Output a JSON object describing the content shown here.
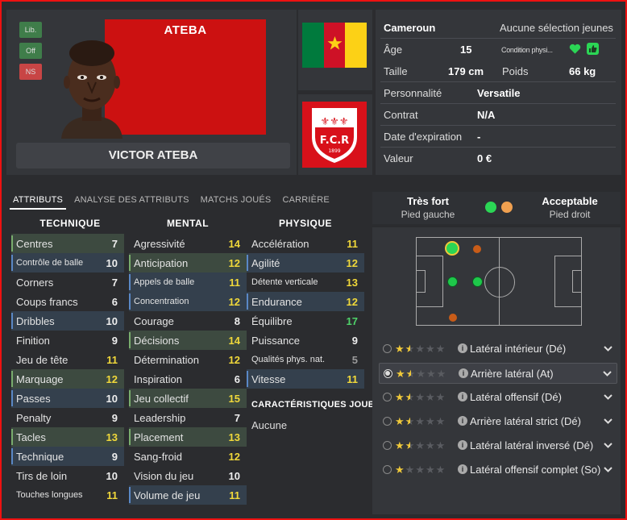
{
  "header": {
    "banner_name": "ATEBA",
    "full_name": "VICTOR ATEBA",
    "tags": [
      "Lib.",
      "Off",
      "NS"
    ]
  },
  "nation": {
    "flag_colors": [
      "#007a3d",
      "#ce1126",
      "#fcd116"
    ],
    "star_color": "#fcd116"
  },
  "club": {
    "badge_color": "#d8111a",
    "badge_text": "F.C.R",
    "year": "1899"
  },
  "info": {
    "country": "Cameroun",
    "selection": "Aucune sélection jeunes",
    "age_label": "Âge",
    "age": "15",
    "condition_label": "Condition physi...",
    "height_label": "Taille",
    "height": "179 cm",
    "weight_label": "Poids",
    "weight": "66 kg",
    "personality_label": "Personnalité",
    "personality": "Versatile",
    "contract_label": "Contrat",
    "contract": "N/A",
    "expiry_label": "Date d'expiration",
    "expiry": "-",
    "value_label": "Valeur",
    "value": "0 €"
  },
  "tabs": [
    "ATTRIBUTS",
    "ANALYSE DES ATTRIBUTS",
    "MATCHS JOUÉS",
    "CARRIÈRE"
  ],
  "sections": {
    "technique": "TECHNIQUE",
    "mental": "MENTAL",
    "physique": "PHYSIQUE"
  },
  "technique": [
    {
      "name": "Centres",
      "value": "7"
    },
    {
      "name": "Contrôle de balle",
      "value": "10"
    },
    {
      "name": "Corners",
      "value": "7"
    },
    {
      "name": "Coups francs",
      "value": "6"
    },
    {
      "name": "Dribbles",
      "value": "10"
    },
    {
      "name": "Finition",
      "value": "9"
    },
    {
      "name": "Jeu de tête",
      "value": "11"
    },
    {
      "name": "Marquage",
      "value": "12"
    },
    {
      "name": "Passes",
      "value": "10"
    },
    {
      "name": "Penalty",
      "value": "9"
    },
    {
      "name": "Tacles",
      "value": "13"
    },
    {
      "name": "Technique",
      "value": "9"
    },
    {
      "name": "Tirs de loin",
      "value": "10"
    },
    {
      "name": "Touches longues",
      "value": "11"
    }
  ],
  "mental": [
    {
      "name": "Agressivité",
      "value": "14"
    },
    {
      "name": "Anticipation",
      "value": "12"
    },
    {
      "name": "Appels de balle",
      "value": "11"
    },
    {
      "name": "Concentration",
      "value": "12"
    },
    {
      "name": "Courage",
      "value": "8"
    },
    {
      "name": "Décisions",
      "value": "14"
    },
    {
      "name": "Détermination",
      "value": "12"
    },
    {
      "name": "Inspiration",
      "value": "6"
    },
    {
      "name": "Jeu collectif",
      "value": "15"
    },
    {
      "name": "Leadership",
      "value": "7"
    },
    {
      "name": "Placement",
      "value": "13"
    },
    {
      "name": "Sang-froid",
      "value": "12"
    },
    {
      "name": "Vision du jeu",
      "value": "10"
    },
    {
      "name": "Volume de jeu",
      "value": "11"
    }
  ],
  "physique": [
    {
      "name": "Accélération",
      "value": "11"
    },
    {
      "name": "Agilité",
      "value": "12"
    },
    {
      "name": "Détente verticale",
      "value": "13"
    },
    {
      "name": "Endurance",
      "value": "12"
    },
    {
      "name": "Équilibre",
      "value": "17"
    },
    {
      "name": "Puissance",
      "value": "9"
    },
    {
      "name": "Qualités phys. nat.",
      "value": "5"
    },
    {
      "name": "Vitesse",
      "value": "11"
    }
  ],
  "traits": {
    "title": "CARACTÉRISTIQUES JOUEUR",
    "value": "Aucune"
  },
  "feet": {
    "left_quality": "Très fort",
    "left_label": "Pied gauche",
    "right_quality": "Acceptable",
    "right_label": "Pied droit",
    "left_color": "#2bd655",
    "right_color": "#f0a050"
  },
  "roles": [
    {
      "name": "Latéral intérieur (Dé)",
      "stars": 1.5
    },
    {
      "name": "Arrière latéral (At)",
      "stars": 1.5
    },
    {
      "name": "Latéral offensif (Dé)",
      "stars": 1.5
    },
    {
      "name": "Arrière latéral strict (Dé)",
      "stars": 1.5
    },
    {
      "name": "Latéral latéral inversé (Dé)",
      "stars": 1.5
    },
    {
      "name": "Latéral offensif complet (So)",
      "stars": 1
    }
  ]
}
